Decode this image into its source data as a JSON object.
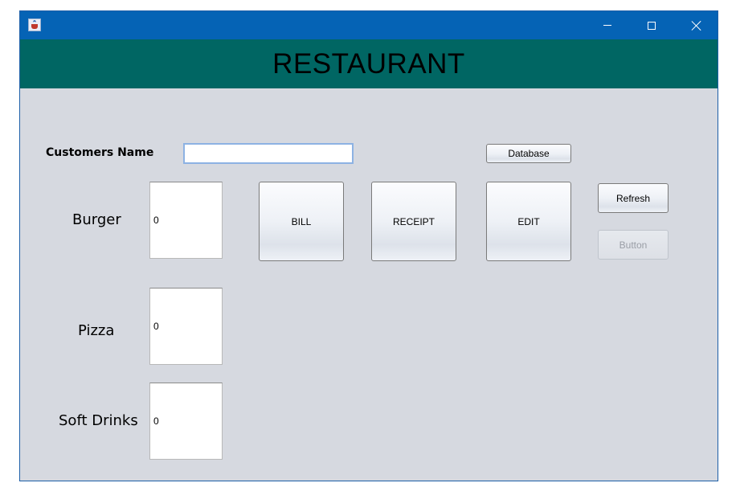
{
  "window": {
    "icon": "java-cup-icon",
    "controls": {
      "minimize": "minimize-icon",
      "maximize": "maximize-icon",
      "close": "close-icon"
    }
  },
  "header": {
    "title": "RESTAURANT"
  },
  "form": {
    "customer_label": "Customers Name",
    "customer_value": "",
    "items": [
      {
        "label": "Burger",
        "qty": "0"
      },
      {
        "label": "Pizza",
        "qty": "0"
      },
      {
        "label": "Soft Drinks",
        "qty": "0"
      }
    ]
  },
  "buttons": {
    "database": "Database",
    "bill": "BILL",
    "receipt": "RECEIPT",
    "edit": "EDIT",
    "refresh": "Refresh",
    "disabled": "Button"
  },
  "colors": {
    "titlebar": "#0563b5",
    "header_band": "#006663",
    "panel": "#d6d9e0"
  }
}
